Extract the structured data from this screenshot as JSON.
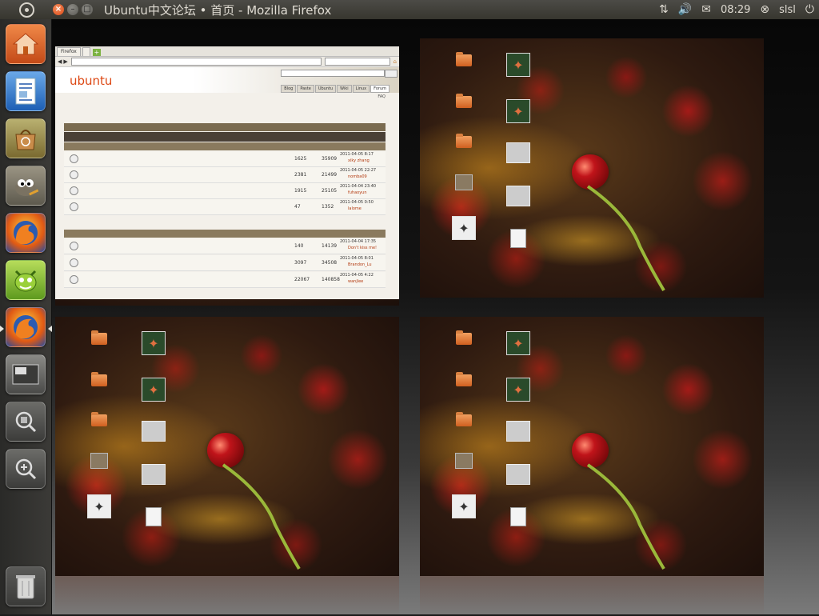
{
  "top_panel": {
    "window_title": "Ubuntu中文论坛 • 首页 - Mozilla Firefox",
    "clock": "08:29",
    "username": "slsl",
    "icons": [
      "ubuntu-logo-icon",
      "network-icon",
      "volume-icon",
      "mail-icon",
      "session-icon",
      "power-icon"
    ]
  },
  "launcher": {
    "items": [
      {
        "name": "home-folder",
        "icon": "home-icon",
        "running": false
      },
      {
        "name": "libreoffice-writer",
        "icon": "document-icon",
        "running": false
      },
      {
        "name": "ubuntu-software-center",
        "icon": "software-center-icon",
        "running": false
      },
      {
        "name": "gimp",
        "icon": "gimp-icon",
        "running": false
      },
      {
        "name": "firefox",
        "icon": "firefox-icon",
        "running": false
      },
      {
        "name": "empathy",
        "icon": "empathy-icon",
        "running": false
      },
      {
        "name": "firefox",
        "icon": "firefox-icon",
        "running": true
      },
      {
        "name": "workspace-switcher",
        "icon": "workspace-icon",
        "running": false
      },
      {
        "name": "dash-search",
        "icon": "search-icon",
        "running": false
      },
      {
        "name": "dash-zoom",
        "icon": "magnifier-plus-icon",
        "running": false
      },
      {
        "name": "trash",
        "icon": "trash-icon",
        "running": false
      }
    ]
  },
  "browser": {
    "tabs": [
      {
        "label": "Firefox"
      },
      {
        "label": ""
      }
    ],
    "url": "",
    "search_placeholder": "",
    "logo": "ubuntu",
    "search_button": "",
    "forum_tabs": [
      "Blog",
      "Paste",
      "Ubuntu",
      "Wiki",
      "Linux",
      "Forum"
    ],
    "breadcrumb": "",
    "faq": "FAQ",
    "time_note": "",
    "table_headers": {
      "forum": "",
      "topics": "",
      "posts": "",
      "last_post": ""
    },
    "categories": [
      {
        "title": "",
        "topics": [
          {
            "name": "",
            "desc": "",
            "topics": "1625",
            "posts": "35909",
            "last_time": "2011-04-05 8:17",
            "last_user": "xiky zhang"
          },
          {
            "name": "",
            "desc": "",
            "topics": "2381",
            "posts": "21499",
            "last_time": "2011-04-05 22:27",
            "last_user": "nomba09"
          },
          {
            "name": "",
            "desc": "",
            "topics": "1915",
            "posts": "25105",
            "last_time": "2011-04-04 23:40",
            "last_user": "fuhaoyun"
          },
          {
            "name": "",
            "desc": "",
            "topics": "47",
            "posts": "1352",
            "last_time": "2011-04-05 0:50",
            "last_user": "lalome"
          }
        ]
      },
      {
        "title": "",
        "topics": [
          {
            "name": "",
            "desc": "",
            "topics": "140",
            "posts": "14139",
            "last_time": "2011-04-04 17:35",
            "last_user": "Don't kiss me!"
          },
          {
            "name": "",
            "desc": "",
            "topics": "3097",
            "posts": "34508",
            "last_time": "2011-04-05 8:01",
            "last_user": "Brandon_Lu"
          },
          {
            "name": "",
            "desc": "",
            "topics": "22067",
            "posts": "140858",
            "last_time": "2011-04-05 4:22",
            "last_user": "wanjlee"
          }
        ]
      }
    ]
  },
  "desktop_icons": [
    {
      "type": "folder",
      "label": ""
    },
    {
      "type": "picture",
      "label": "",
      "sub": ""
    },
    {
      "type": "folder",
      "label": ""
    },
    {
      "type": "picture",
      "label": "",
      "sub": ""
    },
    {
      "type": "folder",
      "label": ""
    },
    {
      "type": "blank",
      "label": "",
      "sub": ""
    },
    {
      "type": "archive",
      "label": "",
      "sub": ""
    },
    {
      "type": "blank",
      "label": "",
      "sub": ""
    },
    {
      "type": "picture2",
      "label": "",
      "sub": ""
    },
    {
      "type": "doc",
      "label": "",
      "sub": ""
    }
  ],
  "colors": {
    "accent": "#dd4814",
    "panel": "#3c3b37",
    "berry": "#c0141a"
  }
}
